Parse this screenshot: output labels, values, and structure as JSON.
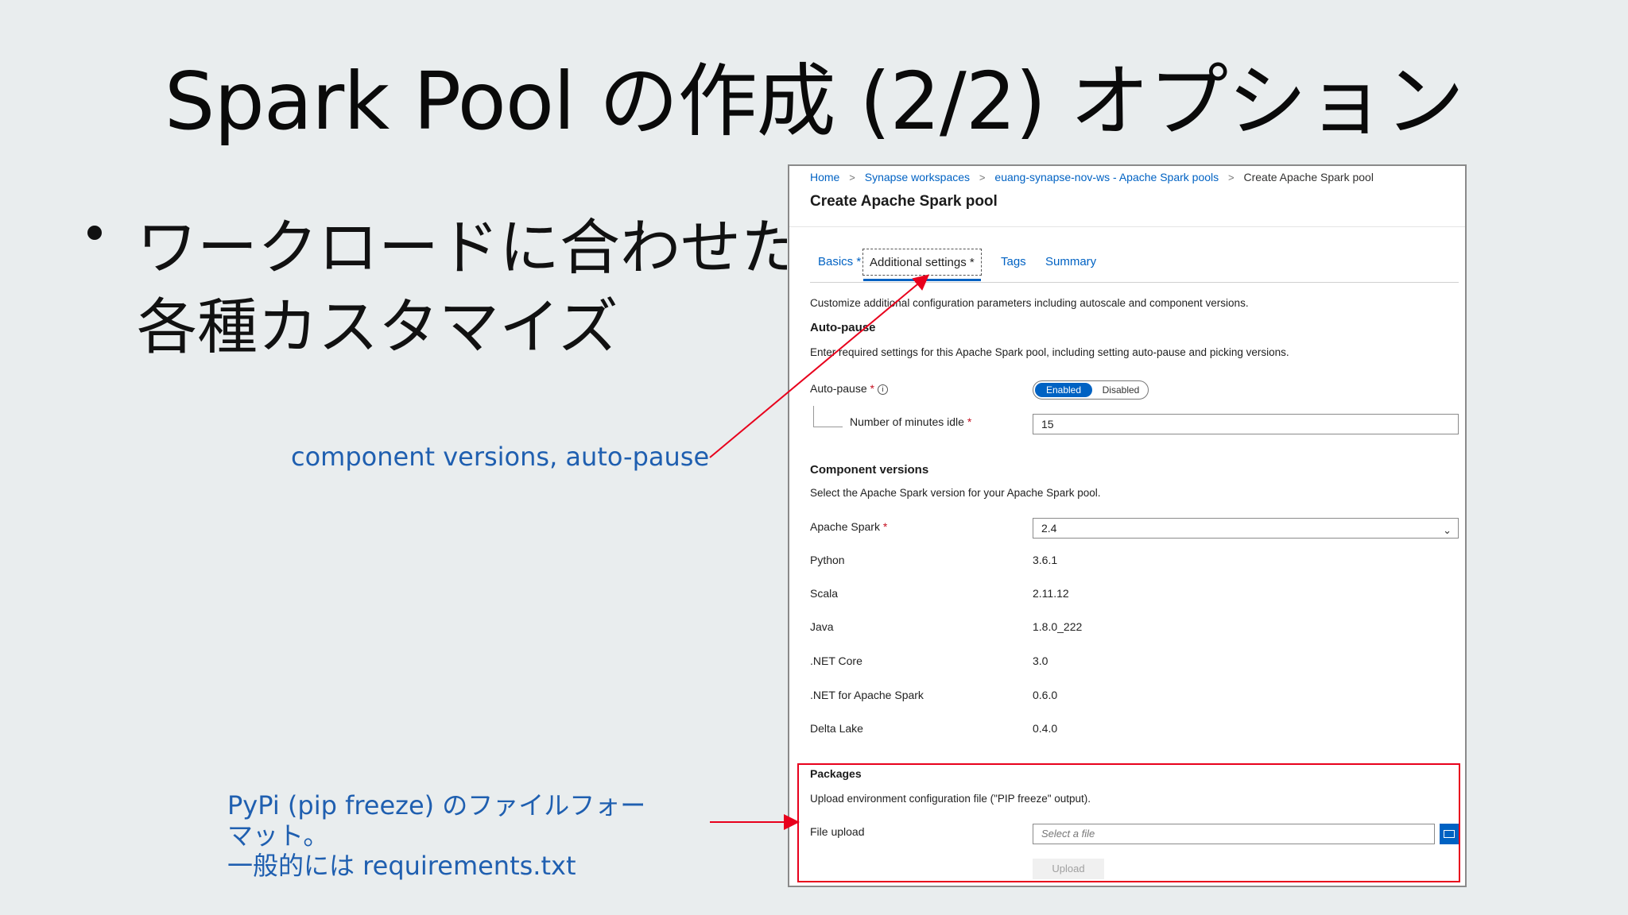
{
  "slide": {
    "title": "Spark Pool の作成 (2/2) オプション",
    "bullet_line1": "ワークロードに合わせた",
    "bullet_line2": "各種カスタマイズ",
    "callout1": "component versions, auto-pause",
    "callout2_line1": "PyPi (pip freeze) のファイルフォー",
    "callout2_line2": "マット。",
    "callout2_line3": "一般的には requirements.txt",
    "callout_color": "#1f5fb0",
    "arrow_color": "#e8001c"
  },
  "portal": {
    "breadcrumb": {
      "home": "Home",
      "workspaces": "Synapse workspaces",
      "pools": "euang-synapse-nov-ws - Apache Spark pools",
      "current": "Create Apache Spark pool",
      "separator": ">"
    },
    "title": "Create Apache Spark pool",
    "tabs": {
      "basics": "Basics",
      "additional": "Additional settings",
      "tags": "Tags",
      "summary": "Summary",
      "required_mark": "*"
    },
    "description": "Customize additional configuration parameters including autoscale and component versions.",
    "autopause": {
      "heading": "Auto-pause",
      "description": "Enter required settings for this Apache Spark pool, including setting auto-pause and picking versions.",
      "label": "Auto-pause",
      "toggle_on": "Enabled",
      "toggle_off": "Disabled",
      "minutes_label": "Number of minutes idle",
      "minutes_value": "15"
    },
    "components": {
      "heading": "Component versions",
      "description": "Select the Apache Spark version for your Apache Spark pool.",
      "spark_label": "Apache Spark",
      "spark_value": "2.4",
      "rows": [
        {
          "label": "Python",
          "value": "3.6.1"
        },
        {
          "label": "Scala",
          "value": "2.11.12"
        },
        {
          "label": "Java",
          "value": "1.8.0_222"
        },
        {
          "label": ".NET Core",
          "value": "3.0"
        },
        {
          "label": ".NET for Apache Spark",
          "value": "0.6.0"
        },
        {
          "label": "Delta Lake",
          "value": "0.4.0"
        }
      ]
    },
    "packages": {
      "heading": "Packages",
      "description": "Upload environment configuration file (\"PIP freeze\" output).",
      "file_label": "File upload",
      "file_placeholder": "Select a file",
      "upload_label": "Upload"
    },
    "accent_color": "#0062c3"
  }
}
